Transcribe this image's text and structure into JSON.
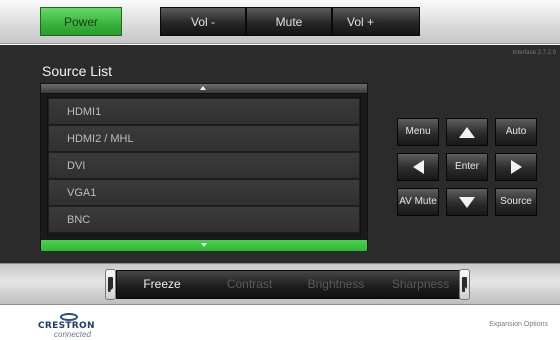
{
  "top_bar": {
    "buttons": [
      {
        "label": "Power",
        "active": true
      },
      {
        "label": "Vol -"
      },
      {
        "label": "Mute"
      },
      {
        "label": "Vol +"
      }
    ]
  },
  "interface_version": "Interface 2.7.2.9",
  "source_list": {
    "title": "Source List",
    "items": [
      "HDMI1",
      "HDMI2 / MHL",
      "DVI",
      "VGA1",
      "BNC"
    ]
  },
  "keypad": {
    "menu": "Menu",
    "auto": "Auto",
    "enter": "Enter",
    "av_mute": "AV Mute",
    "source": "Source"
  },
  "bottom_tabs": {
    "items": [
      {
        "label": "Freeze",
        "active": true
      },
      {
        "label": "Contrast"
      },
      {
        "label": "Brightness"
      },
      {
        "label": "Sharpness"
      }
    ]
  },
  "footer": {
    "logo_text": "CRESTRON",
    "logo_sub": "connected",
    "expansion": "Expansion Options"
  },
  "colors": {
    "accent_green": "#3cb53f",
    "panel_dark": "#2b2b2b"
  }
}
